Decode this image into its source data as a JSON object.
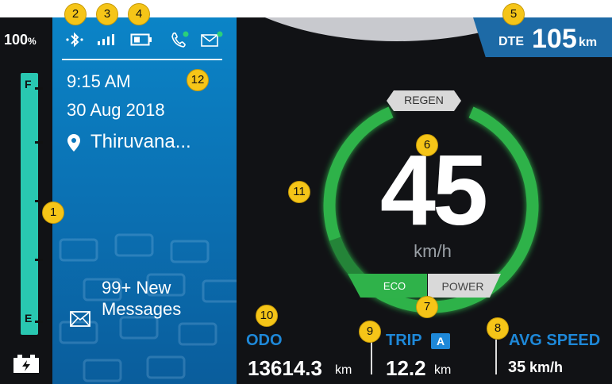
{
  "status": {
    "battery_percent": "100",
    "percent_sign": "%"
  },
  "info": {
    "time": "9:15 AM",
    "date": "30 Aug 2018",
    "location": "Thiruvana...",
    "messages_line1": "99+ New",
    "messages_line2": "Messages"
  },
  "fuel": {
    "full_label": "F",
    "empty_label": "E",
    "level": 1.0
  },
  "dte": {
    "label": "DTE",
    "value": "105",
    "unit": "km"
  },
  "speed": {
    "value": "45",
    "unit": "km/h"
  },
  "modes": {
    "regen": "REGEN",
    "eco": "ECO",
    "power": "POWER",
    "active": "ECO"
  },
  "stats": {
    "odo": {
      "title": "ODO",
      "value": "13614.3",
      "unit": "km"
    },
    "trip": {
      "title": "TRIP",
      "badge": "A",
      "value": "12.2",
      "unit": "km"
    },
    "avg": {
      "title": "AVG SPEED",
      "value": "35",
      "unit": "km/h"
    }
  },
  "callouts": [
    "1",
    "2",
    "3",
    "4",
    "5",
    "6",
    "7",
    "8",
    "9",
    "10",
    "11",
    "12"
  ],
  "colors": {
    "accent": "#29c7b1",
    "panel": "#0b6fb1",
    "gauge": "#2fb24a",
    "stat_title": "#1e88d8"
  }
}
